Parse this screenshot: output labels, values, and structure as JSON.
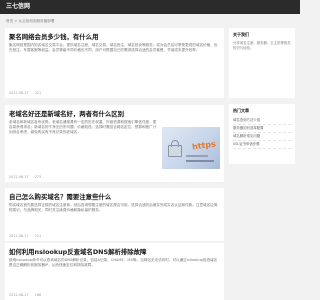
{
  "site": {
    "logo": "三七信网",
    "breadcrumb": "首页 > 从云检测到服务器部署"
  },
  "articles": [
    {
      "title": "聚名网络会员多少钱，有什么用",
      "excerpt": "聚名网络是国内知名域名交易平台，提供域名注册、域名交易、域名抢注、域名拍卖等服务。成为会员后可享受更低的域名价格、优先抢注、专属客服等权益。会员等级不同价格也不同，用户可根据自己的需求选择合适的会员套餐，节省成本提升效率。",
      "date": "2022-06-17",
      "views": "321"
    },
    {
      "title": "老域名好还是新域名好，两者有什么区别",
      "excerpt": "老域名和新域名各有优势。老域名通常具有一定的历史权重、外链资源和搜索引擎信任度，更容易获得排名；新域名则干净无历史问题，价格较低。选择时需结合网站定位、预算和推广计划综合考虑，避免购买有不良记录的老域名。",
      "date": "2022-06-17",
      "views": "273"
    },
    {
      "title": "自己怎么购买域名？需要注意些什么",
      "excerpt": "购买域名首先要选择正规的域名注册商，然后查询想要注册的域名是否可用，选择合适的后缀并完成实名认证和付款。注意域名应简短易记、与品牌相关，同时关注续费价格和隐私保护服务。",
      "date": "2022-06-17",
      "views": "211"
    },
    {
      "title": "如何利用nslookup反查域名DNS解析排除故障",
      "excerpt": "使用nslookup命令可以查询域名的DNS解析记录，包括A记录、CNAME、MX等。当网站无法访问时，可以通过nslookup检查域名是否正确解析到服务器IP，从而快速定位和排除故障。",
      "date": "2022-06-17",
      "views": "188"
    }
  ],
  "thumb": {
    "https_text": "https"
  },
  "sidebar": {
    "box1": {
      "title": "关于我们",
      "text": "分享域名注册、服务器、云主机等相关知识与经验。"
    },
    "box2": {
      "title": "热门文章",
      "links": [
        "域名查询方法介绍",
        "服务器如何选择配置",
        "域名解析常见问题",
        "SSL证书申请步骤"
      ]
    }
  }
}
